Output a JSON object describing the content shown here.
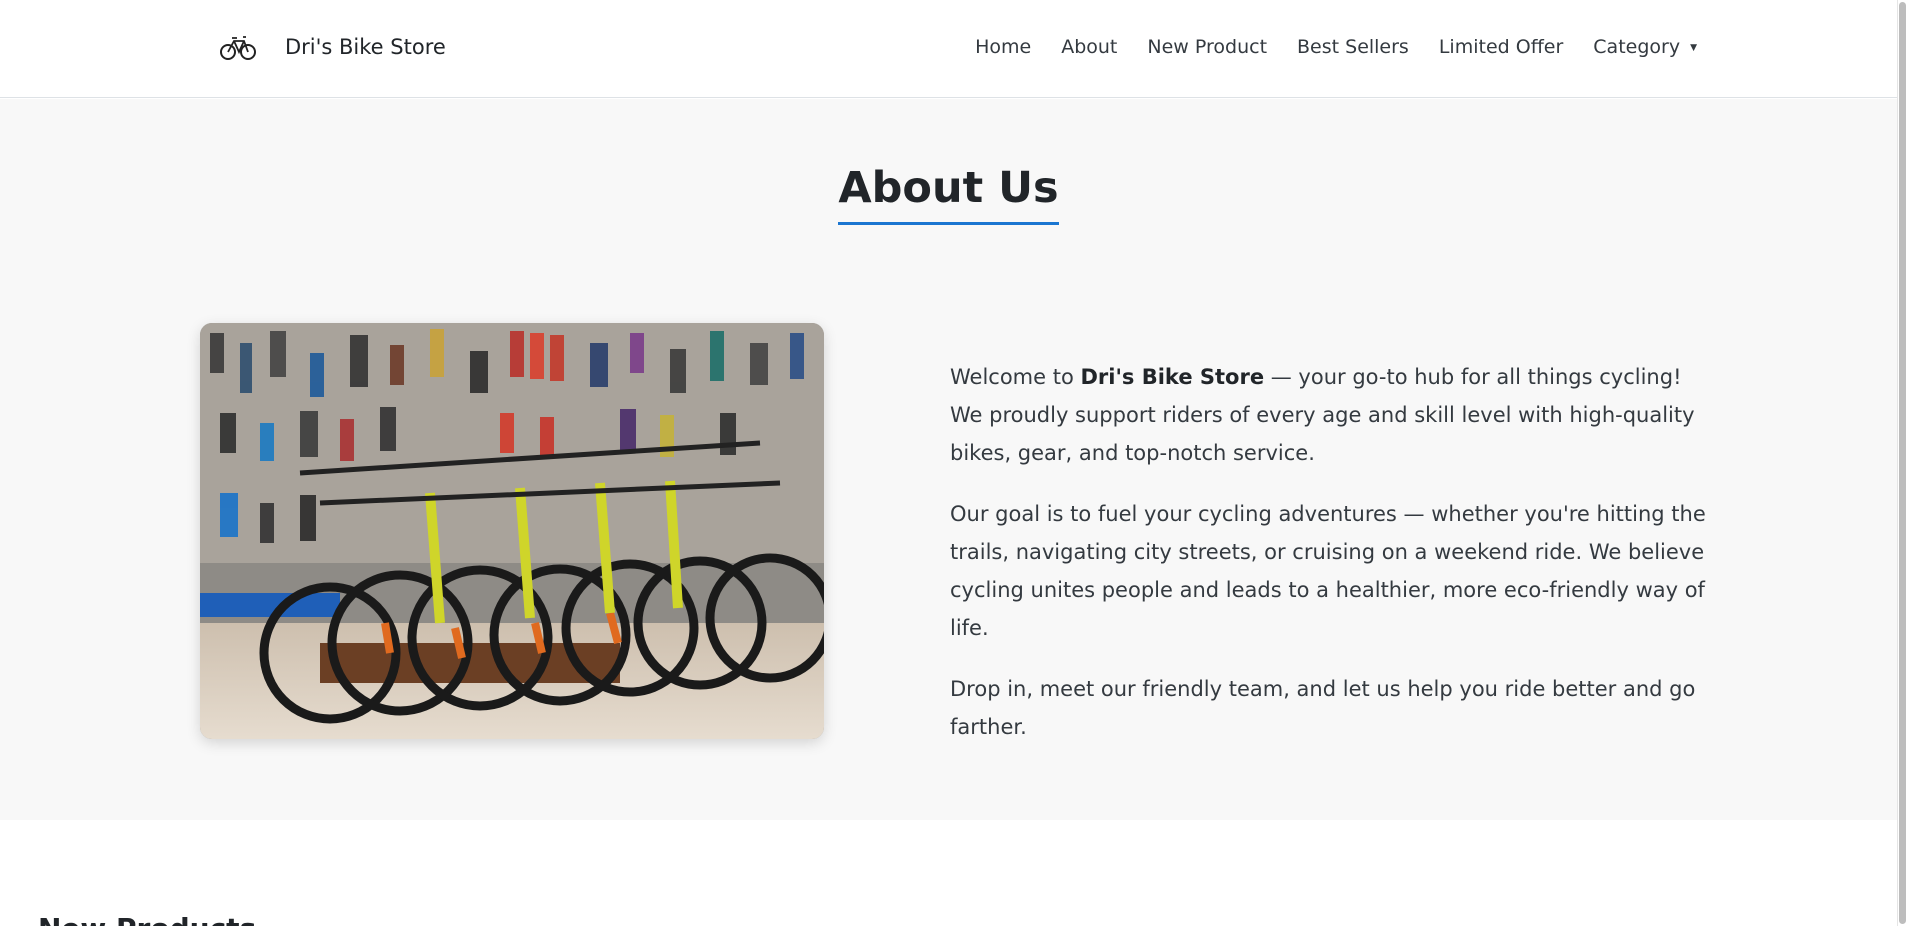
{
  "brand": {
    "name": "Dri's Bike Store",
    "logo_icon": "bicycle-icon"
  },
  "nav": {
    "items": [
      {
        "label": "Home"
      },
      {
        "label": "About"
      },
      {
        "label": "New Product"
      },
      {
        "label": "Best Sellers"
      },
      {
        "label": "Limited Offer"
      },
      {
        "label": "Category"
      }
    ],
    "category_caret_icon": "caret-down-icon"
  },
  "about": {
    "title": "About Us",
    "accent_color": "#1b76d1",
    "image_alt": "bicycles in a bike shop",
    "p1_prefix": "Welcome to ",
    "p1_bold": "Dri's Bike Store",
    "p1_suffix": " — your go-to hub for all things cycling! We proudly support riders of every age and skill level with high-quality bikes, gear, and top-notch service.",
    "p2": "Our goal is to fuel your cycling adventures — whether you're hitting the trails, navigating city streets, or cruising on a weekend ride. We believe cycling unites people and leads to a healthier, more eco-friendly way of life.",
    "p3": "Drop in, meet our friendly team, and let us help you ride better and go farther."
  },
  "next_section": {
    "title": "New Products"
  }
}
